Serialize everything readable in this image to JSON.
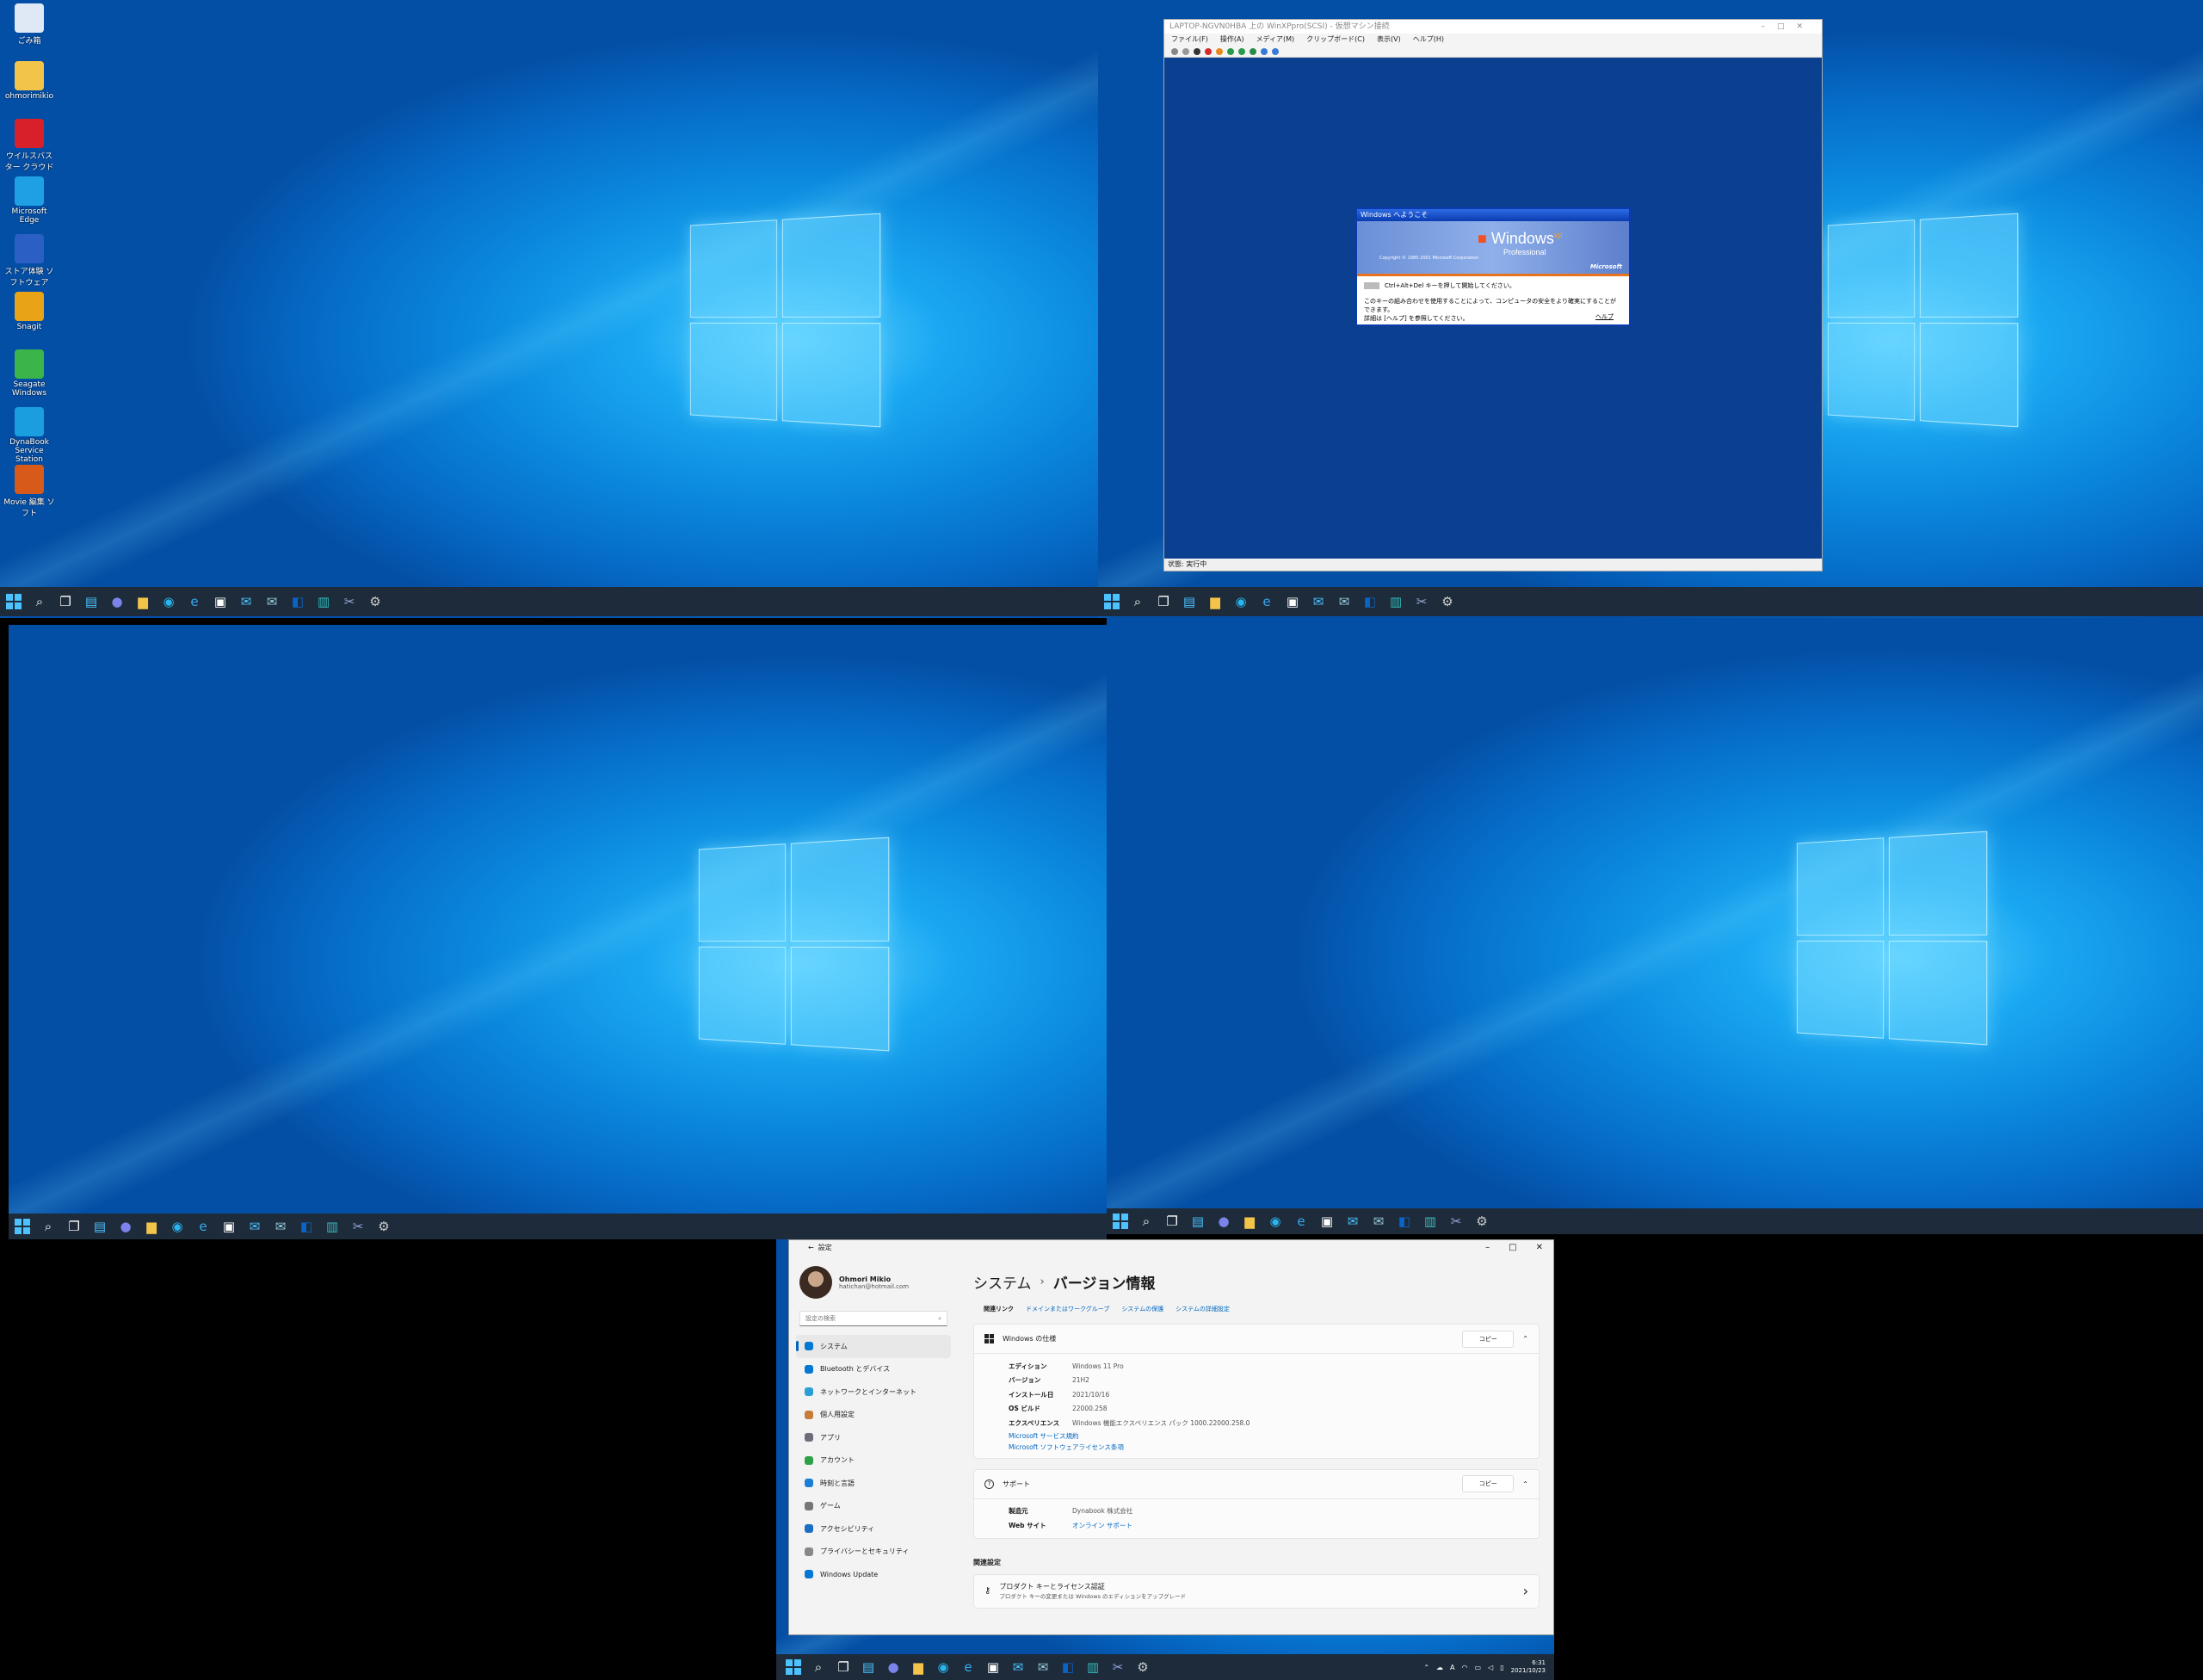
{
  "desktop_icons": [
    {
      "label": "ごみ箱",
      "icon": "recycle-bin-icon",
      "color": "#dfe9f5"
    },
    {
      "label": "ohmorimikio",
      "icon": "folder-icon",
      "color": "#f2c54a"
    },
    {
      "label": "ウイルスバスター クラウド",
      "icon": "antivirus-icon",
      "color": "#d8202a"
    },
    {
      "label": "Microsoft Edge",
      "icon": "edge-icon",
      "color": "#1fa0e4"
    },
    {
      "label": "ストア体験 ソフトウェア",
      "icon": "store-app-icon",
      "color": "#2b5fc4"
    },
    {
      "label": "Snagit",
      "icon": "snagit-icon",
      "color": "#e8a317"
    },
    {
      "label": "Seagate Windows",
      "icon": "seagate-icon",
      "color": "#3bb54a"
    },
    {
      "label": "DynaBook Service Station",
      "icon": "service-station-icon",
      "color": "#1a9ee0"
    },
    {
      "label": "Movie 編集 ソフト",
      "icon": "movie-editor-icon",
      "color": "#d85a1b"
    }
  ],
  "vm": {
    "title": "LAPTOP-NGVN0HBA 上の WinXPpro(SCSI) - 仮想マシン接続",
    "menu": [
      "ファイル(F)",
      "操作(A)",
      "メディア(M)",
      "クリップボード(C)",
      "表示(V)",
      "ヘルプ(H)"
    ],
    "status": "状態: 実行中",
    "xp_dialog": {
      "title": "Windows へようこそ",
      "logo_text": "Windows",
      "logo_sup": "xp",
      "edition": "Professional",
      "copyright": "Copyright © 1985-2001 Microsoft Corporation",
      "brand": "Microsoft",
      "line1": "Ctrl+Alt+Del キーを押して開始してください。",
      "line2": "このキーの組み合わせを使用することによって、コンピュータの安全をより確実にすることができます。",
      "line3": "詳細は [ヘルプ] を参照してください。",
      "help": "ヘルプ"
    }
  },
  "settings": {
    "title": "設定",
    "user_name": "Ohmori Mikio",
    "user_email": "hatichan@hotmail.com",
    "search_placeholder": "設定の検索",
    "nav": [
      {
        "label": "システム",
        "color": "#0078d4"
      },
      {
        "label": "Bluetooth とデバイス",
        "color": "#0078d4"
      },
      {
        "label": "ネットワークとインターネット",
        "color": "#2a9fd6"
      },
      {
        "label": "個人用設定",
        "color": "#c77c3c"
      },
      {
        "label": "アプリ",
        "color": "#6c6c7a"
      },
      {
        "label": "アカウント",
        "color": "#2ea04a"
      },
      {
        "label": "時刻と言語",
        "color": "#1a7fd4"
      },
      {
        "label": "ゲーム",
        "color": "#777"
      },
      {
        "label": "アクセシビリティ",
        "color": "#1a6fc4"
      },
      {
        "label": "プライバシーとセキュリティ",
        "color": "#888"
      },
      {
        "label": "Windows Update",
        "color": "#0078d4"
      }
    ],
    "breadcrumb_parent": "システム",
    "breadcrumb_sep": "›",
    "breadcrumb_current": "バージョン情報",
    "links_label": "関連リンク",
    "links": [
      "ドメインまたはワークグループ",
      "システムの保護",
      "システムの詳細設定"
    ],
    "spec_card": {
      "title": "Windows の仕様",
      "copy": "コピー",
      "rows": [
        {
          "k": "エディション",
          "v": "Windows 11 Pro"
        },
        {
          "k": "バージョン",
          "v": "21H2"
        },
        {
          "k": "インストール日",
          "v": "2021/10/16"
        },
        {
          "k": "OS ビルド",
          "v": "22000.258"
        },
        {
          "k": "エクスペリエンス",
          "v": "Windows 機能エクスペリエンス パック 1000.22000.258.0"
        }
      ],
      "link1": "Microsoft サービス規約",
      "link2": "Microsoft ソフトウェアライセンス条項"
    },
    "support_card": {
      "title": "サポート",
      "copy": "コピー",
      "rows": [
        {
          "k": "製造元",
          "v": "Dynabook 株式会社"
        },
        {
          "k": "Web サイト",
          "v": "オンライン サポート"
        }
      ]
    },
    "related_title": "関連設定",
    "product_key_title": "プロダクト キーとライセンス認証",
    "product_key_sub": "プロダクト キーの変更または Windows のエディションをアップグレード"
  },
  "clock": {
    "time": "6:31",
    "date": "2021/10/23"
  },
  "tray_ime": "A"
}
